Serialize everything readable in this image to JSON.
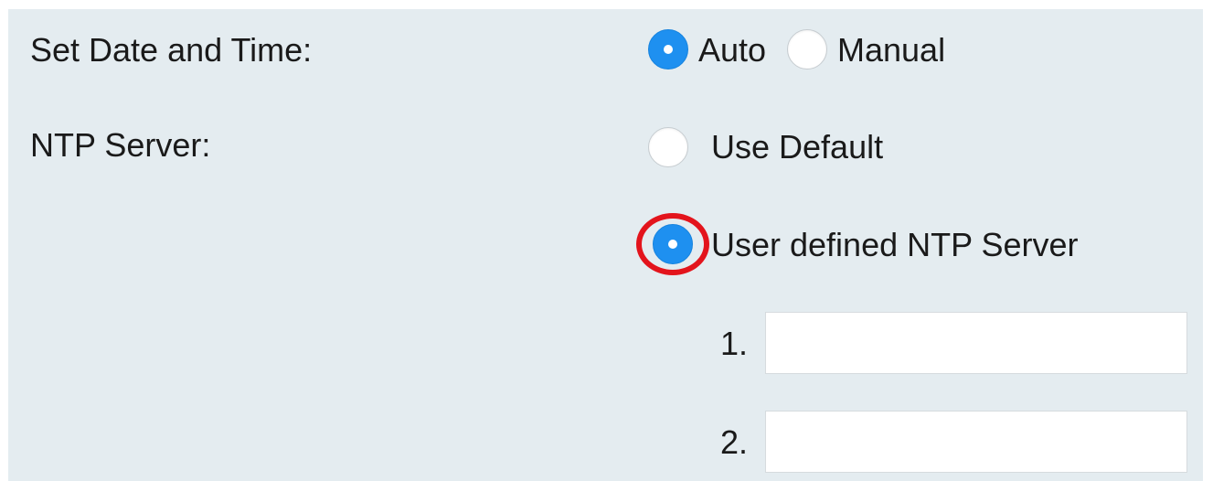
{
  "date_time": {
    "label": "Set Date and Time:",
    "options": [
      "Auto",
      "Manual"
    ],
    "selected": "Auto"
  },
  "ntp": {
    "label": "NTP Server:",
    "options": [
      "Use Default",
      "User defined NTP Server"
    ],
    "selected": "User defined NTP Server",
    "highlighted_option": "User defined NTP Server",
    "servers": [
      {
        "number": "1.",
        "value": "",
        "placeholder": ""
      },
      {
        "number": "2.",
        "value": "",
        "placeholder": ""
      }
    ]
  },
  "colors": {
    "panel_background": "#e4ecf0",
    "radio_selected": "#1e90f0",
    "highlight_ring": "#e3141c"
  }
}
